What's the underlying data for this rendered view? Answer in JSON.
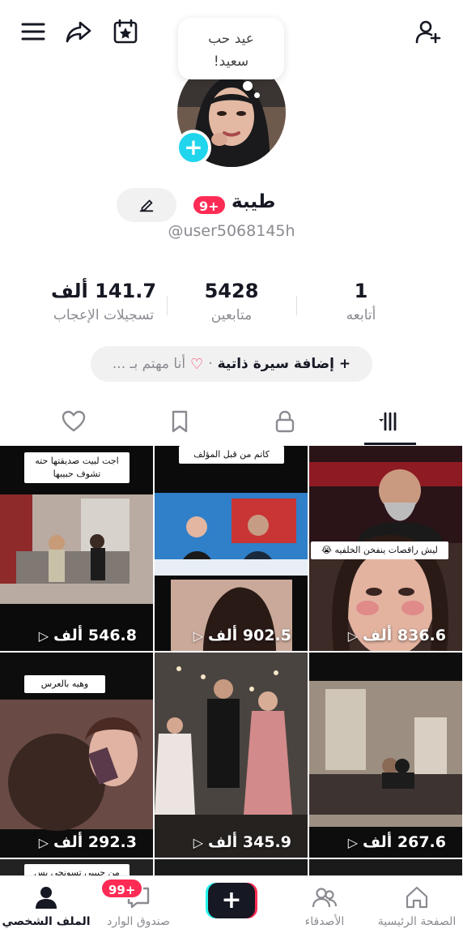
{
  "header": {
    "menu_icon": "hamburger-menu-icon",
    "share_icon": "share-arrow-icon",
    "calendar_icon": "calendar-star-icon",
    "add_friend_icon": "add-user-icon"
  },
  "profile": {
    "note_text": "عيد حب سعيد!",
    "display_name": "طيبة",
    "name_badge": "9+",
    "username": "@user5068145h"
  },
  "stats": {
    "likes_value": "141.7 ألف",
    "likes_label": "تسجيلات الإعجاب",
    "followers_value": "5428",
    "followers_label": "متابعين",
    "following_value": "1",
    "following_label": "أتابعه"
  },
  "bio": {
    "add_bio": "+ إضافة سيرة ذاتية",
    "separator": "·",
    "interest": "أنا مهتم بـ ..."
  },
  "tabs": [
    "videos-grid",
    "private-lock",
    "favorites-bookmark",
    "liked-heart"
  ],
  "videos": [
    {
      "views": "546.8 ألف",
      "caption": "اجت لبيت صديقتها حته تشوف حبيبها"
    },
    {
      "views": "902.5 ألف",
      "caption": "كاتم من قبل المؤلف"
    },
    {
      "views": "836.6 ألف",
      "caption": "ليش راقصات ينفخن الخلفيه 😭"
    },
    {
      "views": "292.3 ألف",
      "caption": "وهيه بالعرس"
    },
    {
      "views": "345.9 ألف",
      "caption": ""
    },
    {
      "views": "267.6 ألف",
      "caption": ""
    }
  ],
  "partial_caption": "من حبيبي تسونجي يس باقيه",
  "bottom_nav": {
    "profile": "الملف الشخصي",
    "inbox": "صندوق الوارد",
    "inbox_badge": "99+",
    "friends": "الأصدقاء",
    "home": "الصفحة الرئيسية"
  },
  "colors": {
    "accent": "#fe2c55",
    "cyan": "#20d5ec",
    "text": "#161823",
    "muted": "#8a8b91"
  }
}
